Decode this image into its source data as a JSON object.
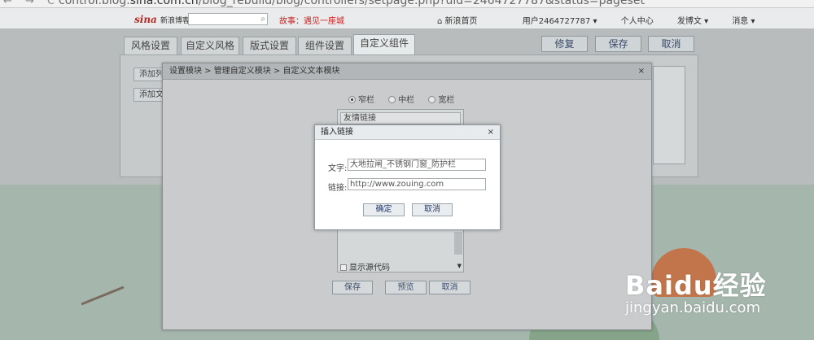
{
  "browser": {
    "url_prefix": "control.blog.",
    "url_host": "sina.com.cn",
    "url_rest": "/blog_rebuild/blog/controllers/setpage.php?uid=2464727787&status=pageset"
  },
  "topbar": {
    "logo": "sina",
    "logo_sub": "新浪博客",
    "story": "故事：遇见一座城",
    "links": [
      "新浪首页",
      "用户2464727787 ▾",
      "个人中心",
      "发博文 ▾",
      "消息 ▾"
    ]
  },
  "tabs": [
    "风格设置",
    "自定义风格",
    "版式设置",
    "组件设置",
    "自定义组件"
  ],
  "actions": {
    "restore": "修复",
    "save": "保存",
    "cancel": "取消"
  },
  "panel": {
    "add1": "添加列",
    "add2": "添加文"
  },
  "modal1": {
    "title": "设置模块 > 管理自定义模块 > 自定义文本模块",
    "close": "×",
    "radios": [
      {
        "label": "窄栏",
        "checked": true
      },
      {
        "label": "中栏",
        "checked": false
      },
      {
        "label": "宽栏",
        "checked": false
      }
    ],
    "module_name": "友情链接",
    "show_source": "显示源代码",
    "buttons": {
      "save": "保存",
      "preview": "预览",
      "cancel": "取消"
    }
  },
  "modal2": {
    "title": "插入链接",
    "close": "×",
    "text_label": "文字:",
    "text_value": "大地拉闸_不锈钢门窗_防护栏",
    "link_label": "链接:",
    "link_value": "http://www.zouing.com",
    "ok": "确定",
    "cancel": "取消"
  },
  "watermark": {
    "brand": "Baidu经验",
    "site": "jingyan.baidu.com"
  }
}
